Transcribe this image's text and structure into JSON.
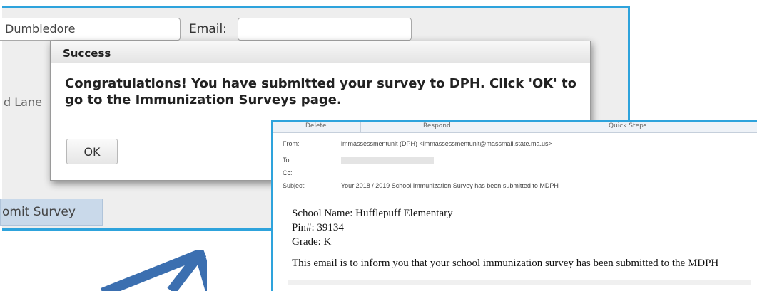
{
  "form": {
    "name_value": "Dumbledore",
    "email_label": "Email:",
    "email_value": "",
    "address_partial": "d Lane",
    "submit_label": "omit Survey"
  },
  "dialog": {
    "title": "Success",
    "message": "Congratulations! You have submitted your survey to DPH. Click 'OK' to go to the Immunization Surveys page.",
    "ok_label": "OK"
  },
  "email": {
    "ribbon": {
      "delete": "Delete",
      "respond": "Respond",
      "quick_steps": "Quick Steps"
    },
    "from_label": "From:",
    "from_value": "immassessmentunit (DPH) <immassessmentunit@massmail.state.ma.us>",
    "to_label": "To:",
    "cc_label": "Cc:",
    "subject_label": "Subject:",
    "subject_value": "Your 2018 / 2019 School Immunization Survey has been submitted to MDPH",
    "body": {
      "school_name": "School Name: Hufflepuff Elementary",
      "pin": "Pin#: 39134",
      "grade": "Grade: K",
      "info": "This email is to inform you that your school immunization survey has been submitted to the MDPH"
    }
  },
  "colors": {
    "frame_border": "#2ea3dc",
    "arrow": "#3b6fb0",
    "submit_bg": "#c9d9ea"
  }
}
